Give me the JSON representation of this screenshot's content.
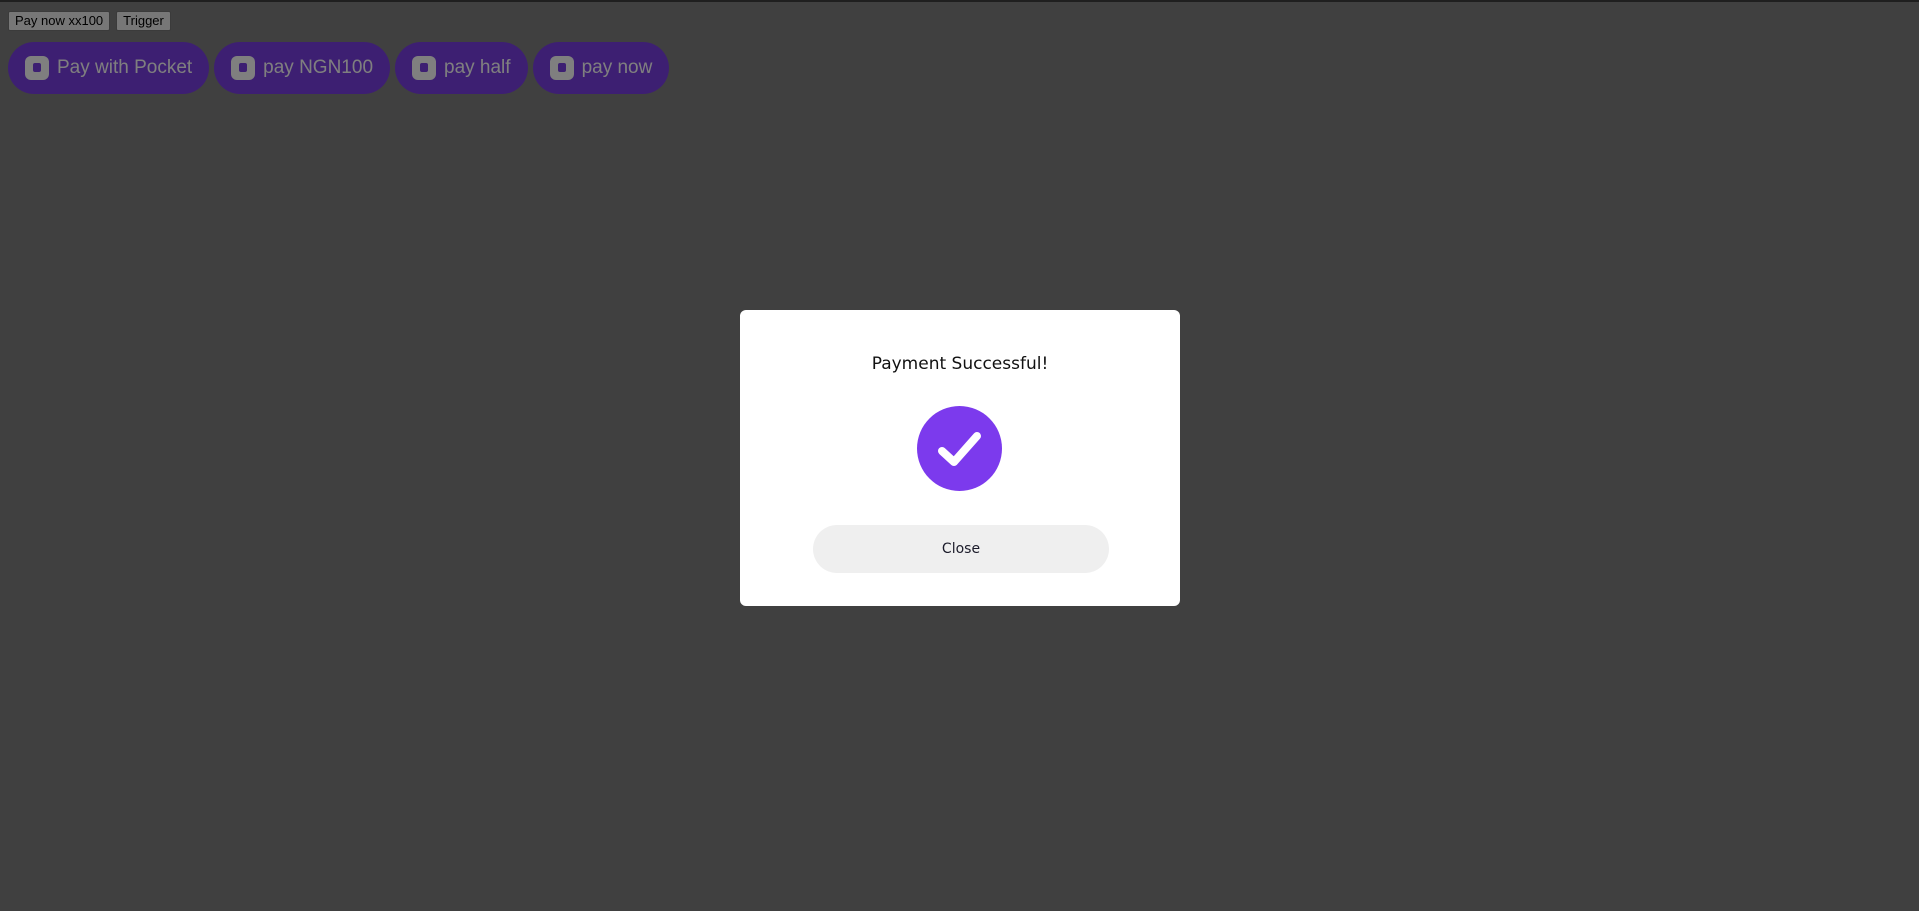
{
  "toolbar": {
    "pay_now_label": "Pay now xx100",
    "trigger_label": "Trigger"
  },
  "pay_buttons": [
    {
      "label": "Pay with Pocket",
      "icon": "wallet-icon"
    },
    {
      "label": "pay NGN100",
      "icon": "wallet-icon"
    },
    {
      "label": "pay half",
      "icon": "wallet-icon"
    },
    {
      "label": "pay now",
      "icon": "wallet-icon"
    }
  ],
  "modal": {
    "title": "Payment Successful!",
    "status_icon": "checkmark-circle-icon",
    "close_label": "Close"
  },
  "colors": {
    "brand": "#7c3aed",
    "overlay": "rgba(0,0,0,0.5)",
    "close_button_bg": "#efefef"
  }
}
